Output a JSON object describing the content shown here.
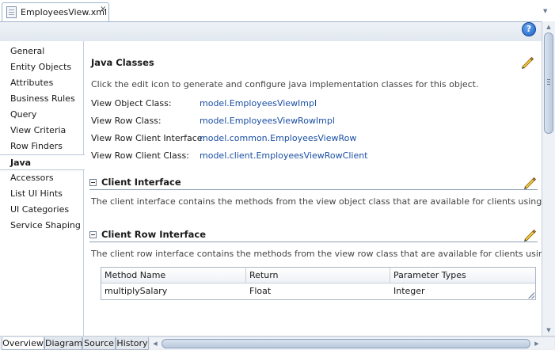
{
  "editor": {
    "tab_title": "EmployeesView.xml",
    "tab_close": "×",
    "help_glyph": "?"
  },
  "nav": {
    "items": [
      {
        "label": "General"
      },
      {
        "label": "Entity Objects"
      },
      {
        "label": "Attributes"
      },
      {
        "label": "Business Rules"
      },
      {
        "label": "Query"
      },
      {
        "label": "View Criteria"
      },
      {
        "label": "Row Finders"
      },
      {
        "label": "Java"
      },
      {
        "label": "Accessors"
      },
      {
        "label": "List UI Hints"
      },
      {
        "label": "UI Categories"
      },
      {
        "label": "Service Shaping"
      }
    ],
    "selected": "Java"
  },
  "java_classes": {
    "title": "Java Classes",
    "description": "Click the edit icon to generate and configure java implementation classes for this object.",
    "rows": [
      {
        "label": "View Object Class:",
        "value": "model.EmployeesViewImpl"
      },
      {
        "label": "View Row Class:",
        "value": "model.EmployeesViewRowImpl"
      },
      {
        "label": "View Row Client Interface:",
        "value": "model.common.EmployeesViewRow"
      },
      {
        "label": "View Row Client Class:",
        "value": "model.client.EmployeesViewRowClient"
      }
    ]
  },
  "client_interface": {
    "title": "Client Interface",
    "description": "The client interface contains the methods from the view object class that are available for clients using this object."
  },
  "client_row_interface": {
    "title": "Client Row Interface",
    "description": "The client row interface contains the methods from the view row class that are available for clients using this object.",
    "columns": [
      "Method Name",
      "Return",
      "Parameter Types"
    ],
    "rows": [
      [
        "multiplySalary",
        "Float",
        "Integer"
      ]
    ]
  },
  "bottom_tabs": {
    "items": [
      {
        "label": "Overview"
      },
      {
        "label": "Diagram"
      },
      {
        "label": "Source"
      },
      {
        "label": "History"
      }
    ],
    "active": "Overview"
  },
  "colors": {
    "link": "#1b4fa3",
    "pencil_yellow": "#f2c744",
    "help_blue": "#1c5fc5"
  }
}
